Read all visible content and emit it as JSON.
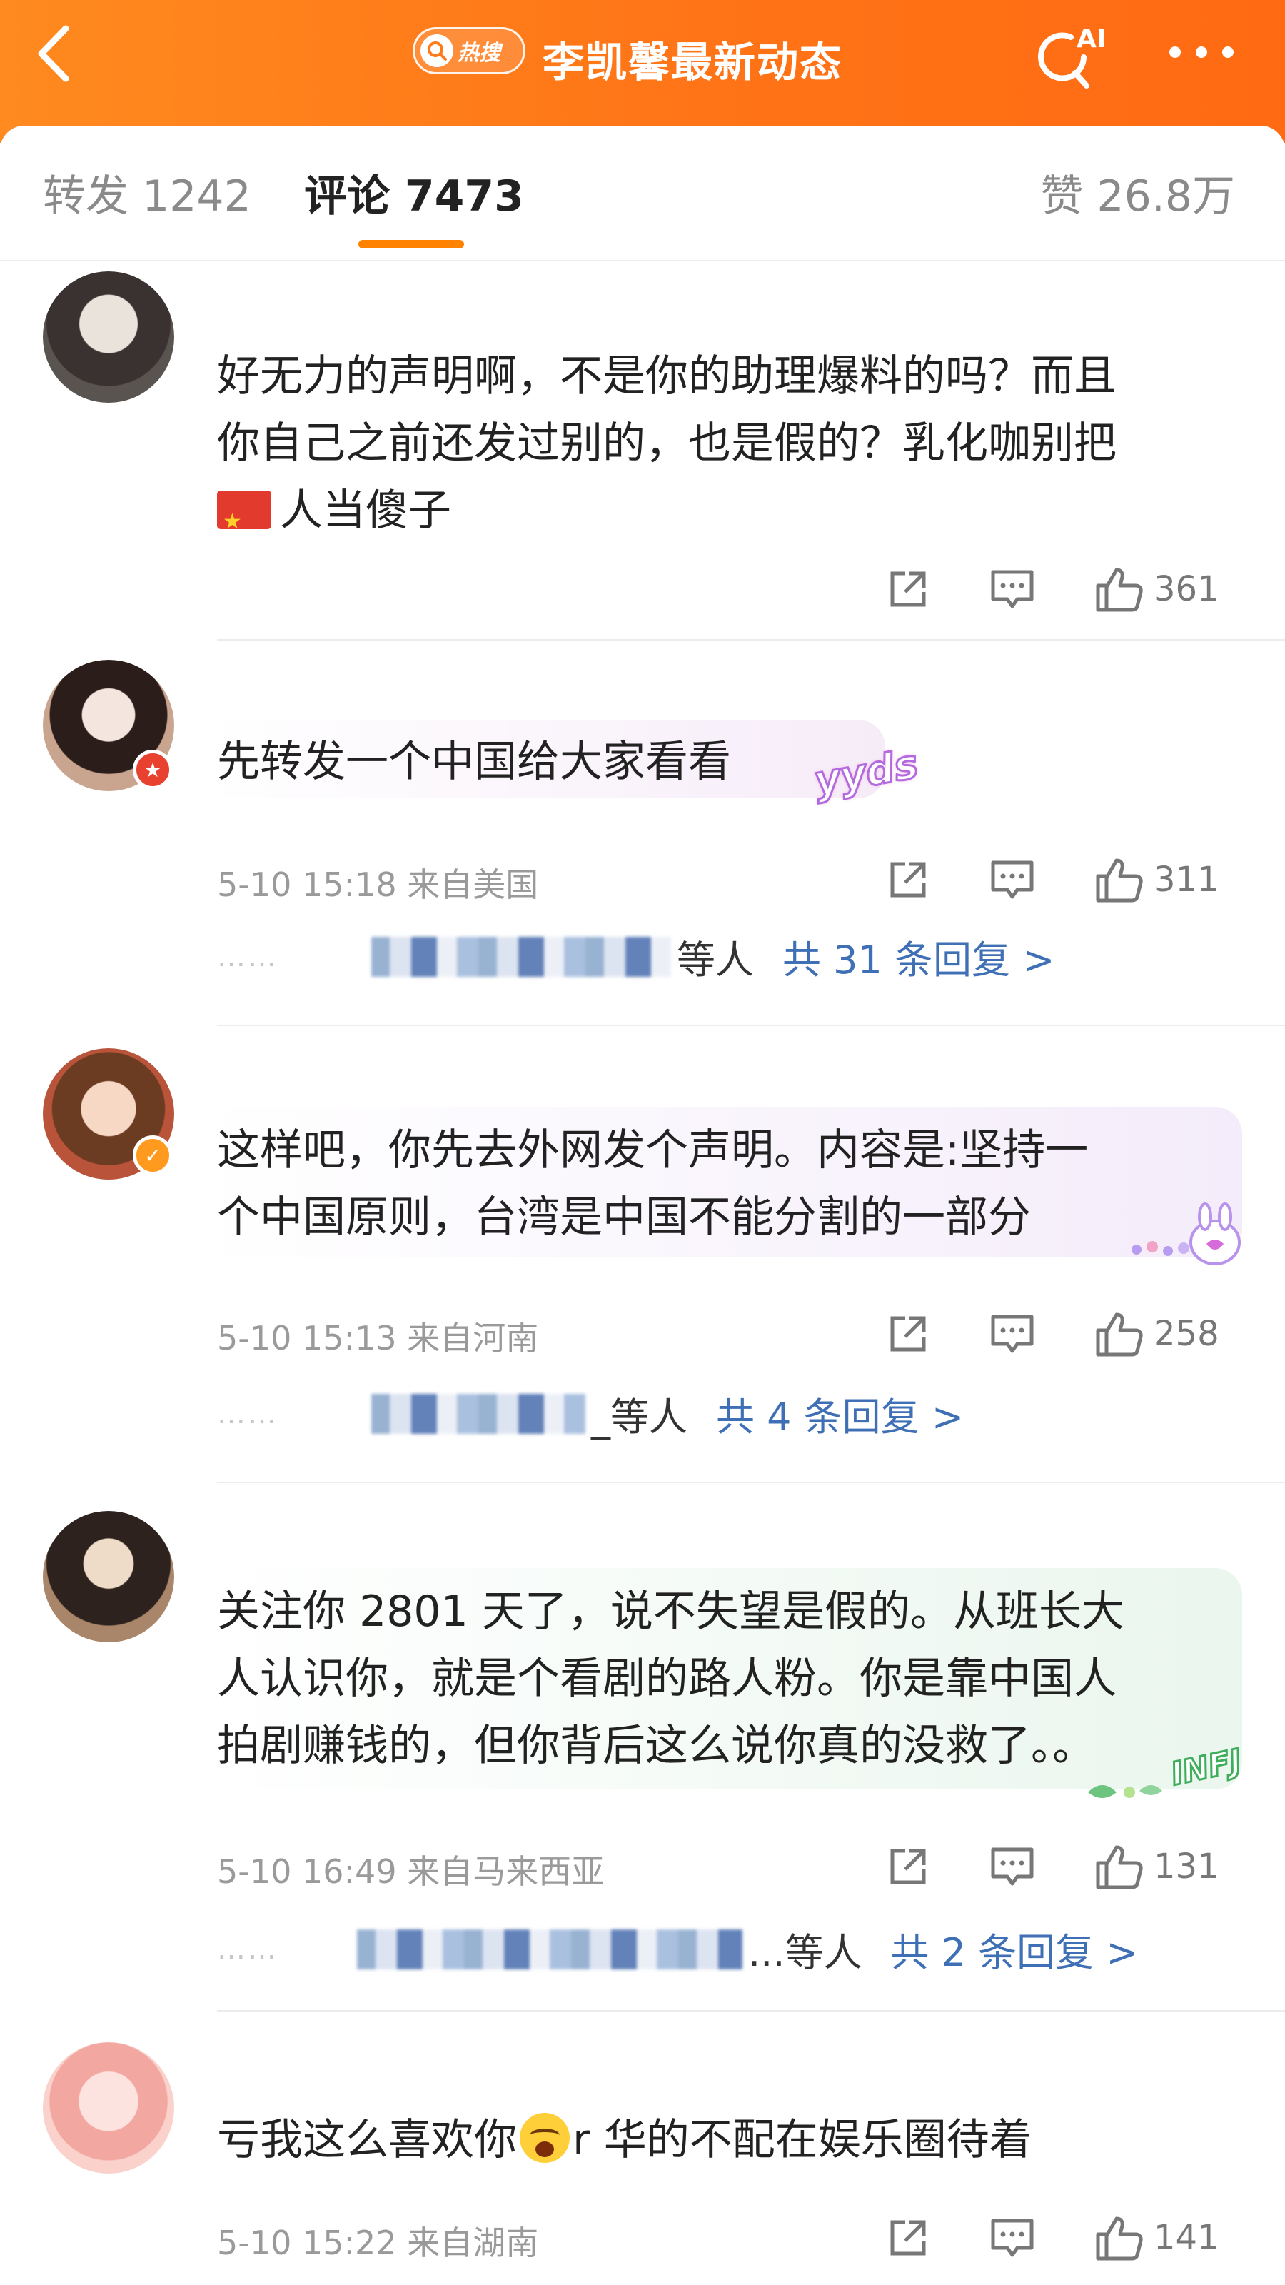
{
  "header": {
    "back_icon": "chevron-left-icon",
    "hot_badge": "热搜",
    "title": "李凯馨最新动态",
    "ai_label": "AI",
    "more_icon": "more-dots-icon",
    "background": "#ff7a1a"
  },
  "tabs": {
    "repost": "转发 1242",
    "comment": "评论 7473",
    "like": "赞 26.8万",
    "accent": "#ff8200"
  },
  "comments": [
    {
      "text_line1": "好无力的声明啊，不是你的助理爆料的吗？而且",
      "text_line2": "你自己之前还发过别的，也是假的？乳化咖别把",
      "text_line3": "人当傻子",
      "likes": "361"
    },
    {
      "text": "先转发一个中国给大家看看",
      "decoration": "yyds",
      "meta": "5-10 15:18 来自美国",
      "likes": "311",
      "replies_suffix": "等人",
      "replies_link": "共 31 条回复 >"
    },
    {
      "text_line1": "这样吧，你先去外网发个声明。内容是:坚持一",
      "text_line2": "个中国原则，台湾是中国不能分割的一部分",
      "meta": "5-10 15:13 来自河南",
      "likes": "258",
      "replies_suffix": "_等人",
      "replies_link": "共 4 条回复 >"
    },
    {
      "text_line1": "关注你 2801 天了，说不失望是假的。从班长大",
      "text_line2": "人认识你，就是个看剧的路人粉。你是靠中国人",
      "text_line3": "拍剧赚钱的，但你背后这么说你真的没救了。。",
      "decoration": "INFJ",
      "meta": "5-10 16:49 来自马来西亚",
      "likes": "131",
      "replies_suffix": "...等人",
      "replies_link": "共 2 条回复 >"
    },
    {
      "text_before": "亏我这么喜欢你",
      "text_after": "r 华的不配在娱乐圈待着",
      "meta": "5-10 15:22 来自湖南",
      "likes": "141"
    }
  ],
  "actions": {
    "share_icon": "share-icon",
    "reply_icon": "reply-icon",
    "like_icon": "thumbs-up-icon"
  },
  "replies_dots": "……",
  "link_color": "#3f6fb5"
}
